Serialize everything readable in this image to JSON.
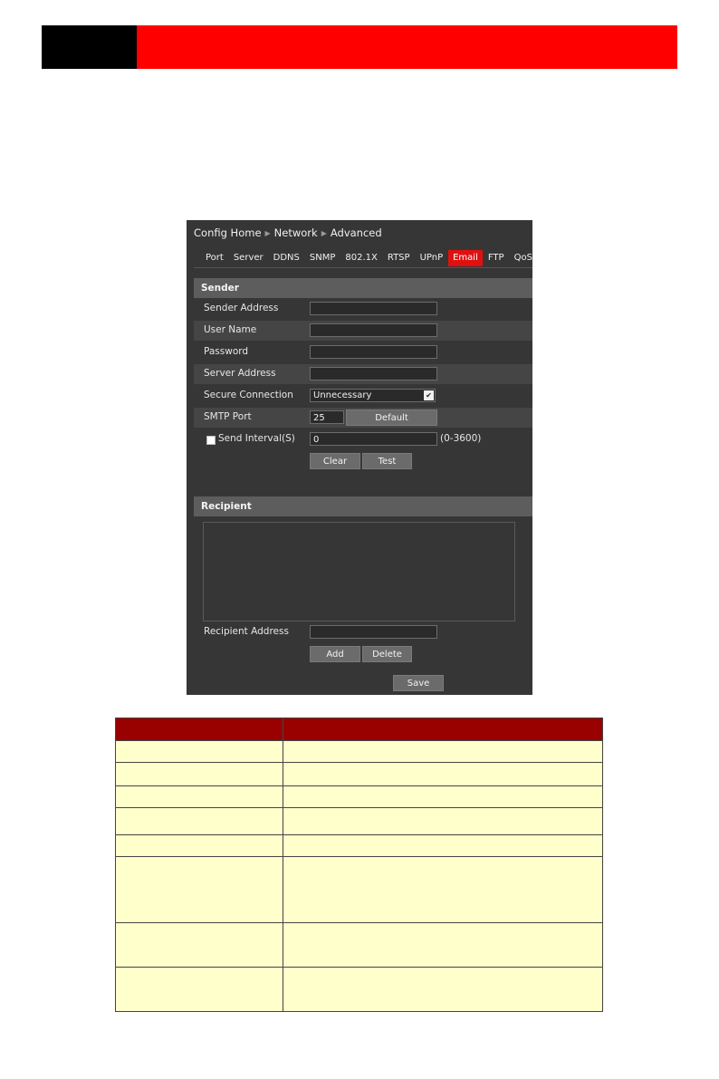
{
  "breadcrumb": [
    "Config Home",
    "Network",
    "Advanced"
  ],
  "tabs": [
    "Port",
    "Server",
    "DDNS",
    "SNMP",
    "802.1X",
    "RTSP",
    "UPnP",
    "Email",
    "FTP",
    "QoS"
  ],
  "active_tab": "Email",
  "sender": {
    "header": "Sender",
    "sender_address_label": "Sender Address",
    "sender_address_value": "",
    "user_name_label": "User Name",
    "user_name_value": "",
    "password_label": "Password",
    "password_value": "",
    "server_address_label": "Server Address",
    "server_address_value": "",
    "secure_connection_label": "Secure Connection",
    "secure_connection_value": "Unnecessary",
    "smtp_port_label": "SMTP Port",
    "smtp_port_value": "25",
    "default_label": "Default",
    "send_interval_label": "Send Interval(S)",
    "send_interval_value": "0",
    "send_interval_range": "(0-3600)",
    "clear_label": "Clear",
    "test_label": "Test"
  },
  "recipient": {
    "header": "Recipient",
    "recipient_address_label": "Recipient Address",
    "recipient_address_value": "",
    "add_label": "Add",
    "delete_label": "Delete"
  },
  "save_label": "Save",
  "colors": {
    "accent_red": "#ff0000",
    "active_tab": "#e01010",
    "table_header": "#990000",
    "table_body": "#ffffcc"
  }
}
